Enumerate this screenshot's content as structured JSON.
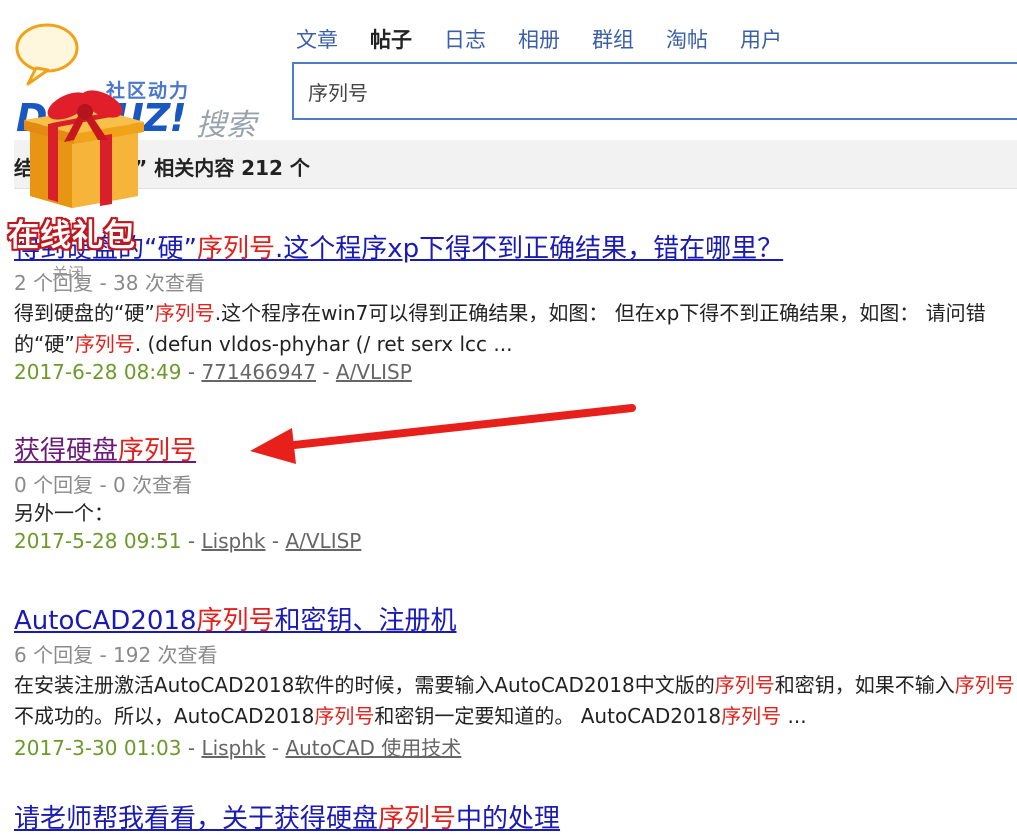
{
  "logo": {
    "subtitle": "社区动力",
    "brand": "DISCUZ!",
    "search_word": "搜索"
  },
  "nav": {
    "items": [
      {
        "label": "文章",
        "active": false
      },
      {
        "label": "帖子",
        "active": true
      },
      {
        "label": "日志",
        "active": false
      },
      {
        "label": "相册",
        "active": false
      },
      {
        "label": "群组",
        "active": false
      },
      {
        "label": "淘帖",
        "active": false
      },
      {
        "label": "用户",
        "active": false
      }
    ]
  },
  "search": {
    "value": "序列号"
  },
  "summary": {
    "text": "结束 “序列号” 相关内容 212 个"
  },
  "results": [
    {
      "title_pre": "得到硬盘的“硬”",
      "title_hl": "序列号",
      "title_post": ".这个程序xp下得不到正确结果，错在哪里？",
      "stats": "2 个回复 - 38 次查看",
      "snippet1_a": "得到硬盘的“硬”",
      "snippet1_hl": "序列号",
      "snippet1_b": ".这个程序在win7可以得到正确结果，如图： 但在xp下得不到正确结果，如图： 请问错",
      "snippet2_a": "的“硬”",
      "snippet2_hl": "序列号",
      "snippet2_b": ". (defun vldos-phyhar (/ ret serx lcc ...",
      "date": "2017-6-28 08:49",
      "author": "771466947",
      "forum": "A/VLISP"
    },
    {
      "title_pre": "获得硬盘",
      "title_hl": "序列号",
      "title_post": "",
      "stats": "0 个回复 - 0 次查看",
      "snippet1_a": "另外一个：",
      "date": "2017-5-28 09:51",
      "author": "Lisphk",
      "forum": "A/VLISP"
    },
    {
      "title_pre": "AutoCAD2018",
      "title_hl": "序列号",
      "title_post": "和密钥、注册机",
      "stats": "6 个回复 - 192 次查看",
      "snippet1_a": "在安装注册激活AutoCAD2018软件的时候，需要输入AutoCAD2018中文版的",
      "snippet1_hl": "序列号",
      "snippet1_b": "和密钥，如果不输入",
      "snippet1_hl2": "序列号",
      "snippet2_a": "不成功的。所以，AutoCAD2018",
      "snippet2_hl": "序列号",
      "snippet2_b": "和密钥一定要知道的。 AutoCAD2018",
      "snippet2_hl2": "序列号",
      "snippet2_c": " ...",
      "date": "2017-3-30 01:03",
      "author": "Lisphk",
      "forum": "AutoCAD 使用技术"
    },
    {
      "title_pre": "请老师帮我看看，关于获得硬盘",
      "title_hl": "序列号",
      "title_post": "中的处理"
    }
  ],
  "ad": {
    "label": "在线礼包",
    "close": "关闭"
  },
  "colors": {
    "accent": "#4d7ec9",
    "highlight": "#e2211c",
    "link": "#1a1ab5",
    "visited": "#6b1a79",
    "date": "#6b9a2b"
  }
}
